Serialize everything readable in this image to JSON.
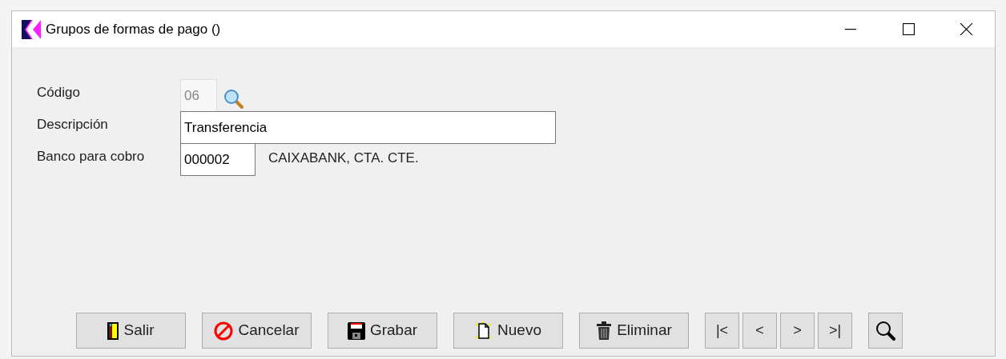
{
  "window": {
    "title": "Grupos de formas de pago ()"
  },
  "fields": [
    {
      "label": "Código",
      "value": "06",
      "disabled": true,
      "kind": "code",
      "lookup": true
    },
    {
      "label": "Descripción",
      "value": "Transferencia",
      "disabled": false,
      "kind": "text",
      "lookup": false
    },
    {
      "label": "Banco para cobro",
      "value": "000002",
      "disabled": false,
      "kind": "account",
      "lookup": false,
      "detail": "CAIXABANK, CTA. CTE."
    }
  ],
  "buttons": [
    {
      "kind": "exit",
      "label": "Salir"
    },
    {
      "kind": "cancel",
      "label": "Cancelar"
    },
    {
      "kind": "save",
      "label": "Grabar"
    },
    {
      "kind": "new",
      "label": "Nuevo"
    },
    {
      "kind": "delete",
      "label": "Eliminar"
    }
  ],
  "navigation": [
    "|<",
    "<",
    ">",
    ">|"
  ]
}
